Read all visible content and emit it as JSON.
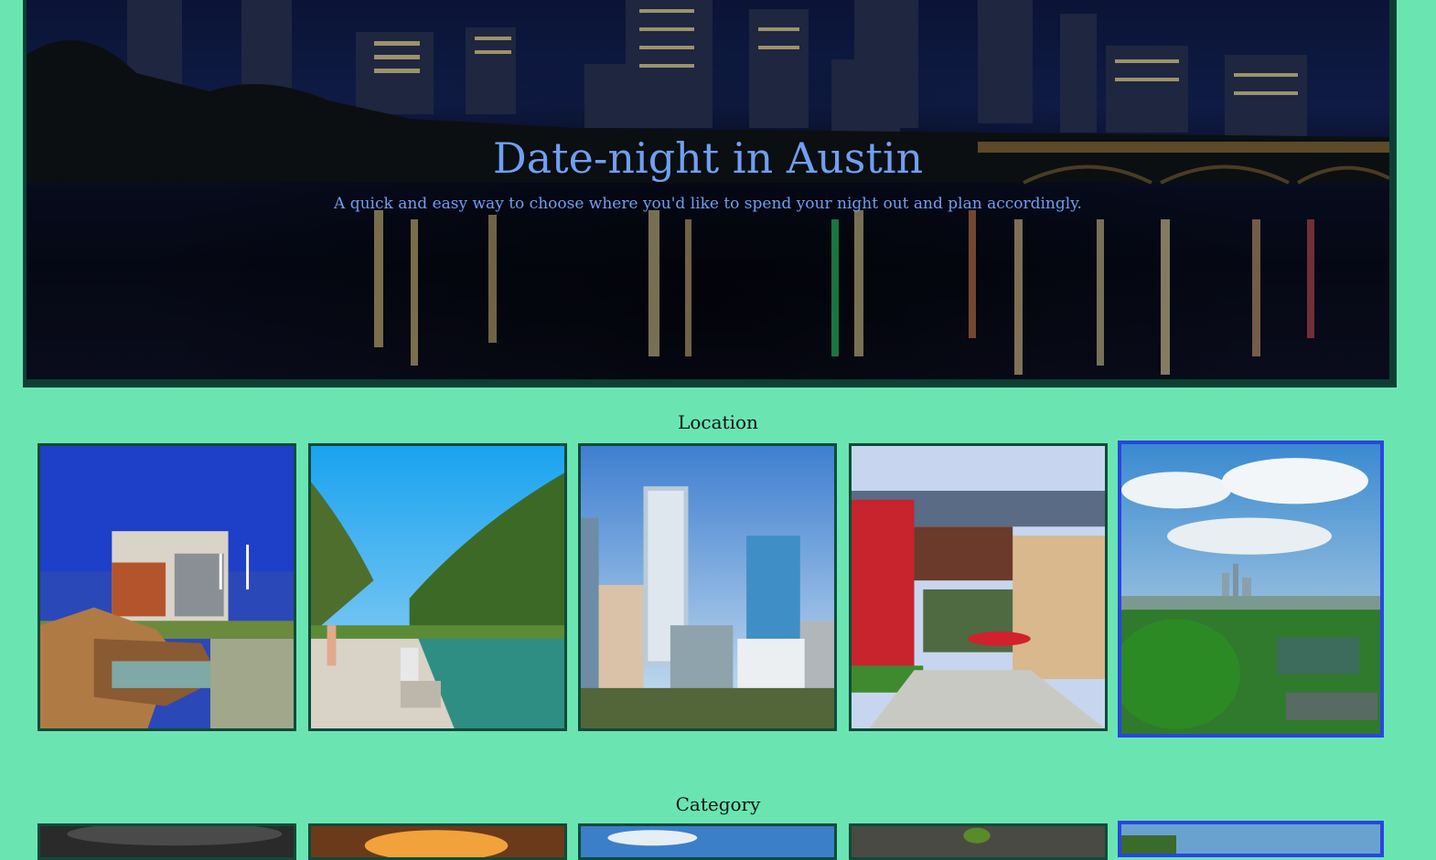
{
  "hero": {
    "title": "Date-night in Austin",
    "subtitle": "A quick and easy way to choose where you'd like to spend your night out and plan accordingly."
  },
  "sections": {
    "location": {
      "title": "Location"
    },
    "category": {
      "title": "Category"
    }
  },
  "location_cards": [
    {
      "name": "city-hall-waterfall-photo",
      "selected": false
    },
    {
      "name": "barton-springs-photo",
      "selected": false
    },
    {
      "name": "downtown-towers-photo",
      "selected": false
    },
    {
      "name": "market-plaza-photo",
      "selected": false
    },
    {
      "name": "skyline-greenery-photo",
      "selected": true
    }
  ],
  "category_cards": [
    {
      "name": "dark-smoke-photo",
      "selected": false
    },
    {
      "name": "sunset-photo",
      "selected": false
    },
    {
      "name": "sky-photo",
      "selected": false
    },
    {
      "name": "food-photo",
      "selected": false
    },
    {
      "name": "outdoor-photo",
      "selected": true
    }
  ],
  "colors": {
    "page_bg": "#6ae5b2",
    "title_blue": "#6f9ff2",
    "card_border": "#0f4a3a",
    "selected_border": "#2a45e0"
  }
}
